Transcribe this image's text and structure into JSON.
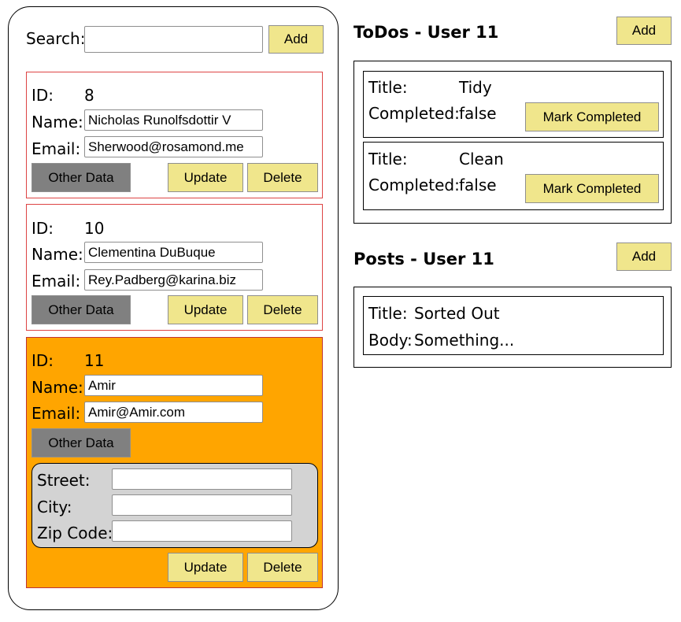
{
  "search": {
    "label": "Search:",
    "value": "",
    "placeholder": "",
    "add_label": "Add"
  },
  "labels": {
    "id": "ID:",
    "name": "Name:",
    "email": "Email:",
    "other_data": "Other Data",
    "update": "Update",
    "delete": "Delete"
  },
  "users": [
    {
      "id": "8",
      "name": "Nicholas Runolfsdottir V",
      "email": "Sherwood@rosamond.me",
      "selected": false
    },
    {
      "id": "10",
      "name": "Clementina DuBuque",
      "email": "Rey.Padberg@karina.biz",
      "selected": false
    },
    {
      "id": "11",
      "name": "Amir",
      "email": "Amir@Amir.com",
      "selected": true
    }
  ],
  "address": {
    "street_label": "Street:",
    "street_value": "",
    "city_label": "City:",
    "city_value": "",
    "zip_label": "Zip Code:",
    "zip_value": ""
  },
  "todos": {
    "title": "ToDos - User 11",
    "add_label": "Add",
    "title_label": "Title:",
    "completed_label": "Completed:",
    "mark_label": "Mark Completed",
    "items": [
      {
        "title": "Tidy",
        "completed": "false"
      },
      {
        "title": "Clean",
        "completed": "false"
      }
    ]
  },
  "posts": {
    "title": "Posts - User 11",
    "add_label": "Add",
    "title_label": "Title:",
    "body_label": "Body:",
    "items": [
      {
        "title": "Sorted Out",
        "body": "Something..."
      }
    ]
  },
  "colors": {
    "button": "#f0e68c",
    "other_data_button": "#808080",
    "selected_card": "#ffa500",
    "card_border": "#dd4444",
    "address_box": "#d3d3d3"
  }
}
